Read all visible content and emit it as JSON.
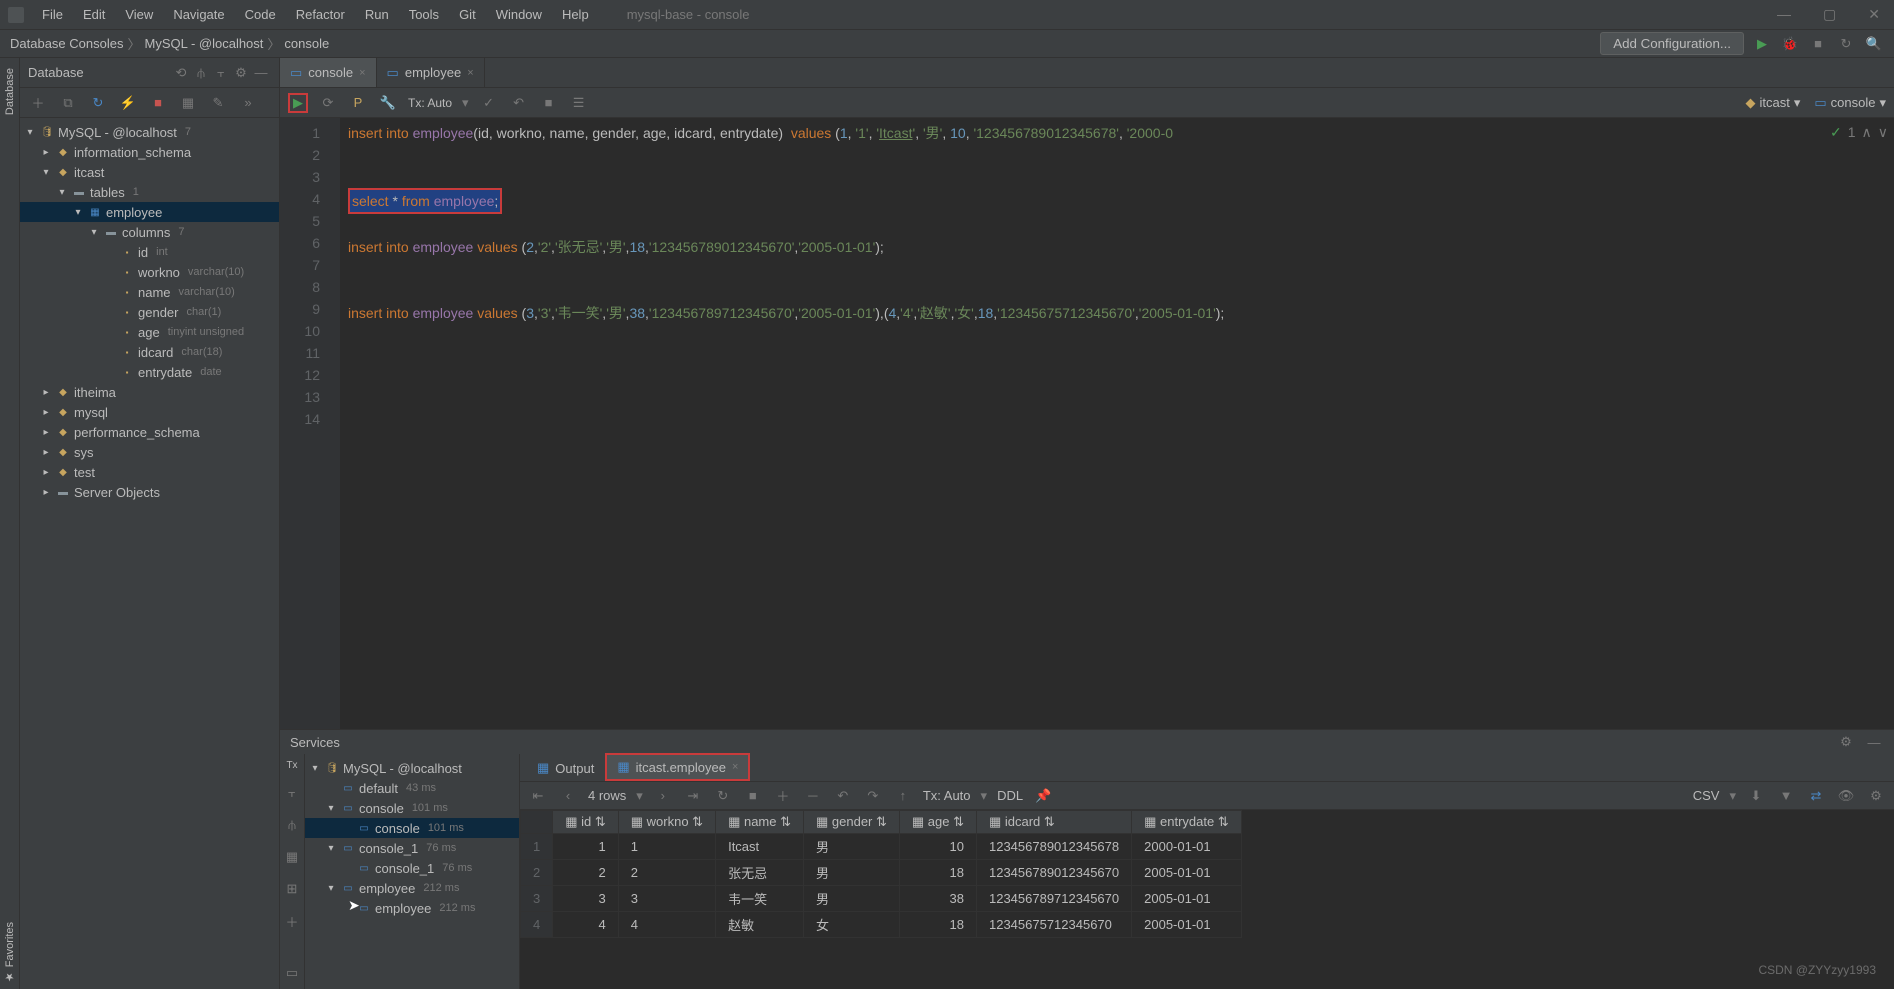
{
  "menubar": {
    "items": [
      "File",
      "Edit",
      "View",
      "Navigate",
      "Code",
      "Refactor",
      "Run",
      "Tools",
      "Git",
      "Window",
      "Help"
    ],
    "project": "mysql-base - console"
  },
  "breadcrumb": {
    "parts": [
      "Database Consoles",
      "MySQL - @localhost",
      "console"
    ],
    "addConfig": "Add Configuration..."
  },
  "dbPanel": {
    "title": "Database"
  },
  "tree": {
    "root": "MySQL - @localhost",
    "rootBadge": "7",
    "schemas": [
      {
        "name": "information_schema"
      },
      {
        "name": "itcast",
        "expanded": true,
        "tables": {
          "label": "tables",
          "count": "1",
          "items": [
            {
              "name": "employee",
              "expanded": true,
              "columnsLabel": "columns",
              "columnsCount": "7",
              "columns": [
                {
                  "name": "id",
                  "type": "int"
                },
                {
                  "name": "workno",
                  "type": "varchar(10)"
                },
                {
                  "name": "name",
                  "type": "varchar(10)"
                },
                {
                  "name": "gender",
                  "type": "char(1)"
                },
                {
                  "name": "age",
                  "type": "tinyint unsigned"
                },
                {
                  "name": "idcard",
                  "type": "char(18)"
                },
                {
                  "name": "entrydate",
                  "type": "date"
                }
              ]
            }
          ]
        }
      },
      {
        "name": "itheima"
      },
      {
        "name": "mysql"
      },
      {
        "name": "performance_schema"
      },
      {
        "name": "sys"
      },
      {
        "name": "test"
      }
    ],
    "serverObjects": "Server Objects"
  },
  "tabs": {
    "items": [
      {
        "label": "console",
        "active": true
      },
      {
        "label": "employee"
      }
    ]
  },
  "editorToolbar": {
    "txAuto": "Tx: Auto",
    "rightLabels": [
      {
        "text": "itcast",
        "icon": "schema"
      },
      {
        "text": "console",
        "icon": "console"
      }
    ]
  },
  "code": {
    "lines": [
      {
        "n": 1,
        "html": "<span class='kw'>insert</span> <span class='kw'>into</span> <span class='ident'>employee</span>(id, workno, name, gender, age, idcard, entrydate)  <span class='kw'>values</span> (<span class='num'>1</span>, <span class='str'>'1'</span>, <span class='str'>'<u>Itcast</u>'</span>, <span class='str'>'男'</span>, <span class='num'>10</span>, <span class='str'>'123456789012345678'</span>, <span class='str'>'2000-0</span>"
      },
      {
        "n": 2,
        "html": ""
      },
      {
        "n": 3,
        "html": ""
      },
      {
        "n": 4,
        "html": "<span class='sel-line'><span class='kw'>select</span> * <span class='kw'>from</span> <span class='ident'>employee</span>;</span>",
        "mark": "✓"
      },
      {
        "n": 5,
        "html": ""
      },
      {
        "n": 6,
        "html": "<span class='kw'>insert</span> <span class='kw'>into</span> <span class='ident'>employee</span> <span class='kw'>values</span> (<span class='num'>2</span>,<span class='str'>'2'</span>,<span class='str'>'张无忌'</span>,<span class='str'>'男'</span>,<span class='num'>18</span>,<span class='str'>'123456789012345670'</span>,<span class='str'>'2005-01-01'</span>);"
      },
      {
        "n": 7,
        "html": ""
      },
      {
        "n": 8,
        "html": ""
      },
      {
        "n": 9,
        "html": "<span class='kw'>insert</span> <span class='kw'>into</span> <span class='ident'>employee</span> <span class='kw'>values</span> (<span class='num'>3</span>,<span class='str'>'3'</span>,<span class='str'>'韦一笑'</span>,<span class='str'>'男'</span>,<span class='num'>38</span>,<span class='str'>'123456789712345670'</span>,<span class='str'>'2005-01-01'</span>),(<span class='num'>4</span>,<span class='str'>'4'</span>,<span class='str'>'赵敏'</span>,<span class='str'>'女'</span>,<span class='num'>18</span>,<span class='str'>'12345675712345670'</span>,<span class='str'>'2005-01-01'</span>);"
      },
      {
        "n": 10,
        "html": ""
      },
      {
        "n": 11,
        "html": ""
      },
      {
        "n": 12,
        "html": ""
      },
      {
        "n": 13,
        "html": ""
      },
      {
        "n": 14,
        "html": ""
      }
    ]
  },
  "services": {
    "title": "Services",
    "toolbar": {
      "rows": "4 rows",
      "txAuto": "Tx: Auto",
      "ddl": "DDL",
      "csv": "CSV"
    },
    "tree": {
      "root": "MySQL - @localhost",
      "items": [
        {
          "name": "default",
          "ms": "43 ms"
        },
        {
          "name": "console",
          "ms": "101 ms",
          "expanded": true,
          "child": {
            "name": "console",
            "ms": "101 ms",
            "selected": true
          }
        },
        {
          "name": "console_1",
          "ms": "76 ms",
          "expanded": true,
          "child": {
            "name": "console_1",
            "ms": "76 ms"
          }
        },
        {
          "name": "employee",
          "ms": "212 ms",
          "expanded": true,
          "child": {
            "name": "employee",
            "ms": "212 ms"
          }
        }
      ]
    },
    "tabs": [
      {
        "label": "Output"
      },
      {
        "label": "itcast.employee",
        "active": true
      }
    ],
    "columns": [
      "id",
      "workno",
      "name",
      "gender",
      "age",
      "idcard",
      "entrydate"
    ],
    "rows": [
      [
        "1",
        "1",
        "Itcast",
        "男",
        "10",
        "123456789012345678",
        "2000-01-01"
      ],
      [
        "2",
        "2",
        "张无忌",
        "男",
        "18",
        "123456789012345670",
        "2005-01-01"
      ],
      [
        "3",
        "3",
        "韦一笑",
        "男",
        "38",
        "123456789712345670",
        "2005-01-01"
      ],
      [
        "4",
        "4",
        "赵敏",
        "女",
        "18",
        "12345675712345670",
        "2005-01-01"
      ]
    ]
  },
  "watermark": "CSDN @ZYYzyy1993"
}
